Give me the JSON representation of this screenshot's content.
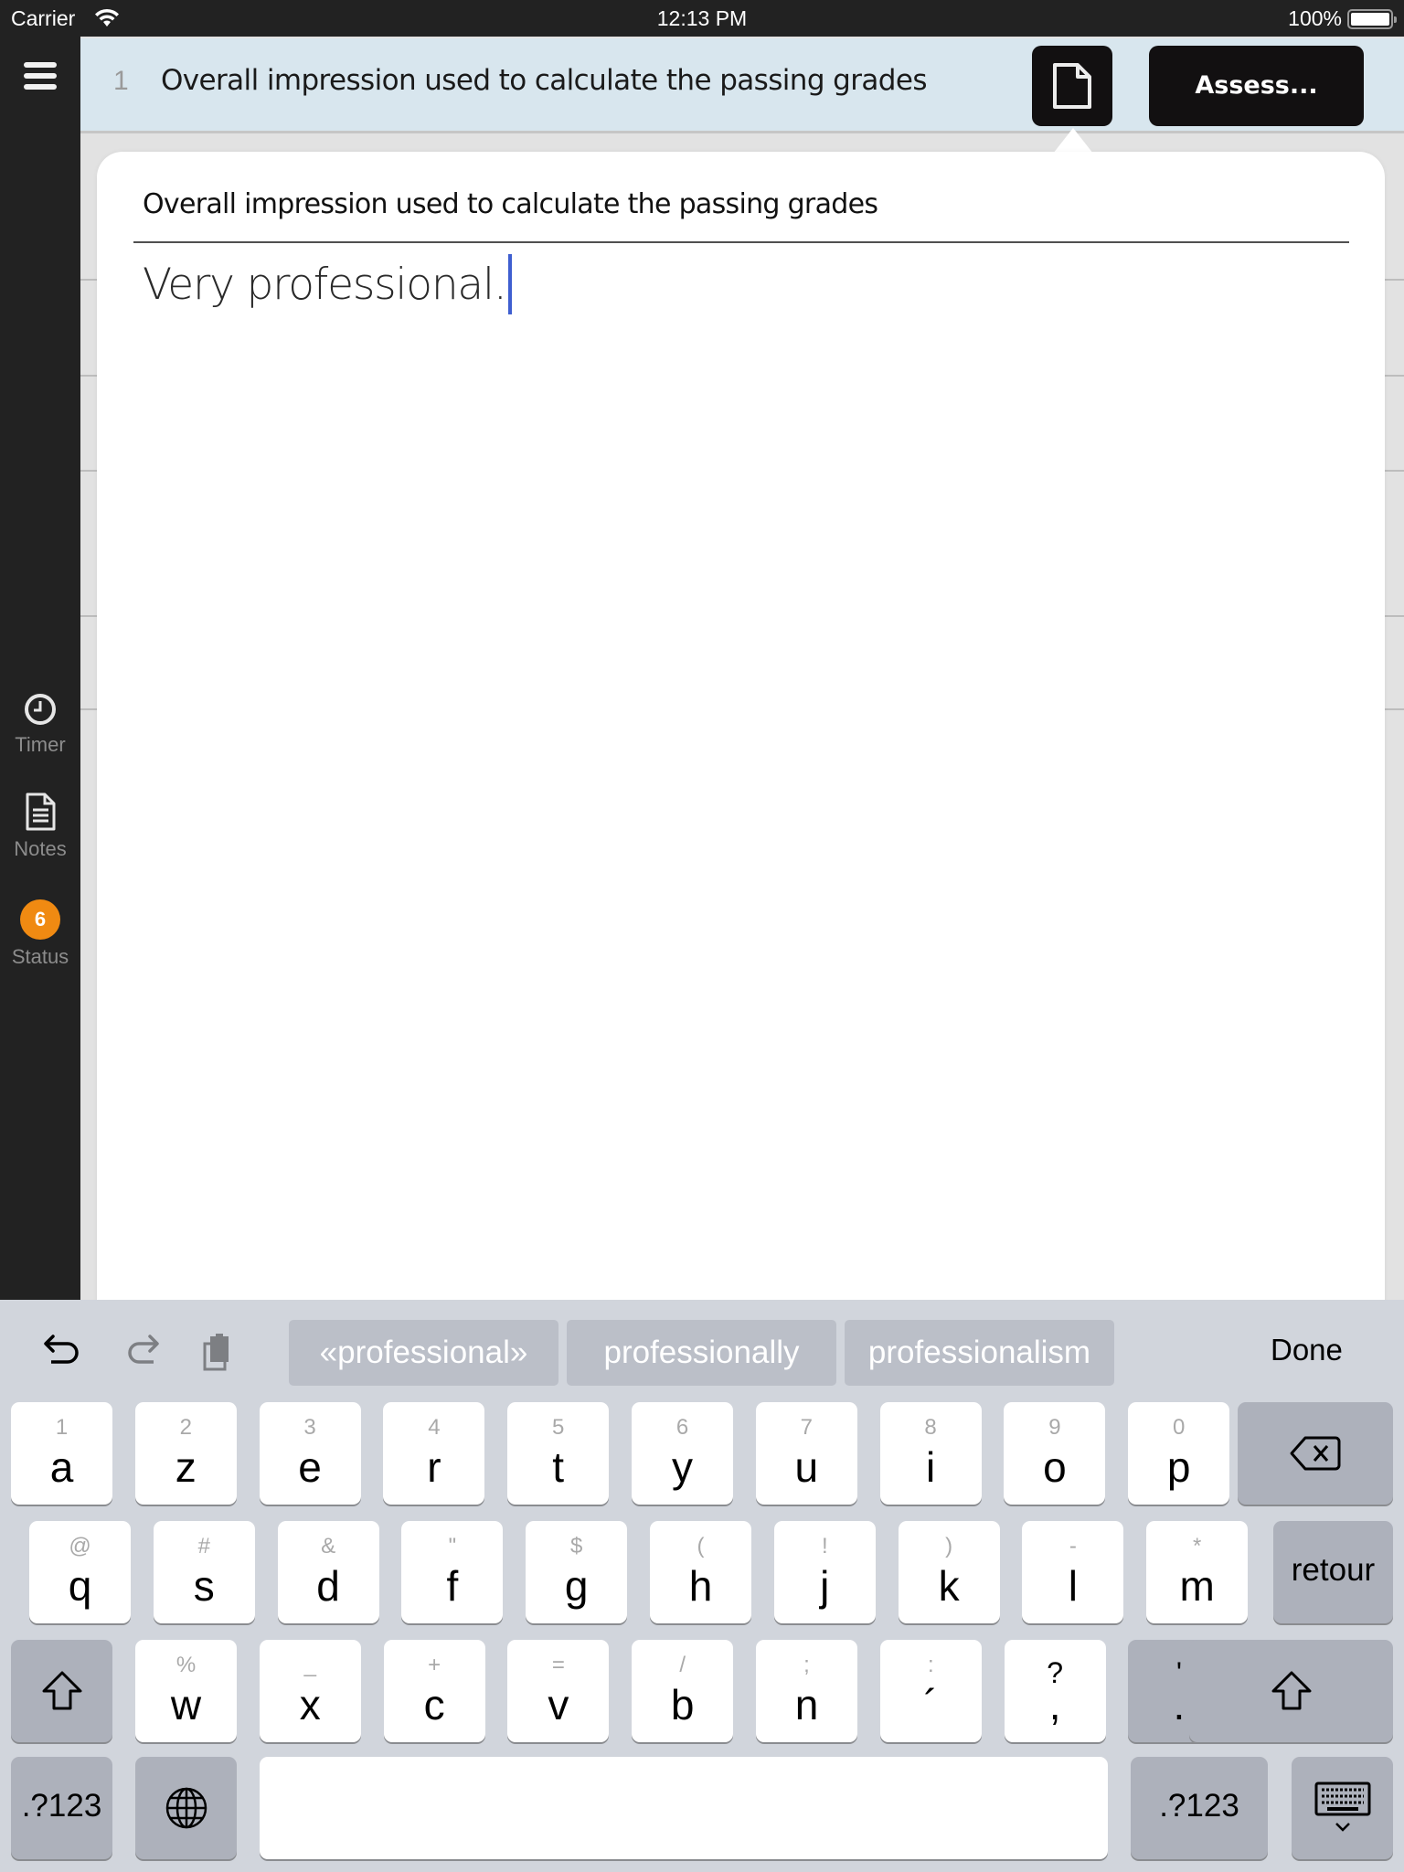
{
  "status_bar": {
    "carrier": "Carrier",
    "time": "12:13 PM",
    "battery": "100%",
    "battery_level": 1.0
  },
  "sidebar": {
    "menu_icon": "hamburger-icon",
    "items": [
      {
        "label": "Timer",
        "icon": "clock-icon"
      },
      {
        "label": "Notes",
        "icon": "document-icon"
      },
      {
        "label": "Status",
        "icon": "badge",
        "badge_count": "6",
        "badge_color": "#f08a12"
      }
    ]
  },
  "header": {
    "row_number": "1",
    "title": "Overall impression used to calculate the passing grades",
    "doc_button_icon": "document-icon",
    "assess_label": "Assess..."
  },
  "popover": {
    "title": "Overall impression used to calculate the passing grades",
    "text_value": "Very professional.",
    "caret_color": "#3f5fd0"
  },
  "keyboard": {
    "toolbar": {
      "undo_icon": "undo-icon",
      "redo_icon": "redo-icon",
      "paste_icon": "paste-icon",
      "suggestions": [
        "«professional»",
        "professionally",
        "professionalism"
      ],
      "done_label": "Done"
    },
    "row1": [
      {
        "alt": "1",
        "key": "a"
      },
      {
        "alt": "2",
        "key": "z"
      },
      {
        "alt": "3",
        "key": "e"
      },
      {
        "alt": "4",
        "key": "r"
      },
      {
        "alt": "5",
        "key": "t"
      },
      {
        "alt": "6",
        "key": "y"
      },
      {
        "alt": "7",
        "key": "u"
      },
      {
        "alt": "8",
        "key": "i"
      },
      {
        "alt": "9",
        "key": "o"
      },
      {
        "alt": "0",
        "key": "p"
      }
    ],
    "row2": [
      {
        "alt": "@",
        "key": "q"
      },
      {
        "alt": "#",
        "key": "s"
      },
      {
        "alt": "&",
        "key": "d"
      },
      {
        "alt": "\"",
        "key": "f"
      },
      {
        "alt": "$",
        "key": "g"
      },
      {
        "alt": "(",
        "key": "h"
      },
      {
        "alt": "!",
        "key": "j"
      },
      {
        "alt": ")",
        "key": "k"
      },
      {
        "alt": "-",
        "key": "l"
      },
      {
        "alt": "*",
        "key": "m"
      }
    ],
    "row3": [
      {
        "alt": "%",
        "key": "w"
      },
      {
        "alt": "_",
        "key": "x"
      },
      {
        "alt": "+",
        "key": "c"
      },
      {
        "alt": "=",
        "key": "v"
      },
      {
        "alt": "/",
        "key": "b"
      },
      {
        "alt": ";",
        "key": "n"
      },
      {
        "alt": ":",
        "key": "´"
      },
      {
        "alt": "?",
        "key": ","
      },
      {
        "alt": "'",
        "key": "."
      }
    ],
    "return_label": "retour",
    "numbers_label": ".?123",
    "delete_icon": "backspace-icon",
    "shift_icon": "shift-icon",
    "globe_icon": "globe-icon",
    "dismiss_icon": "keyboard-dismiss-icon",
    "space_label": ""
  }
}
